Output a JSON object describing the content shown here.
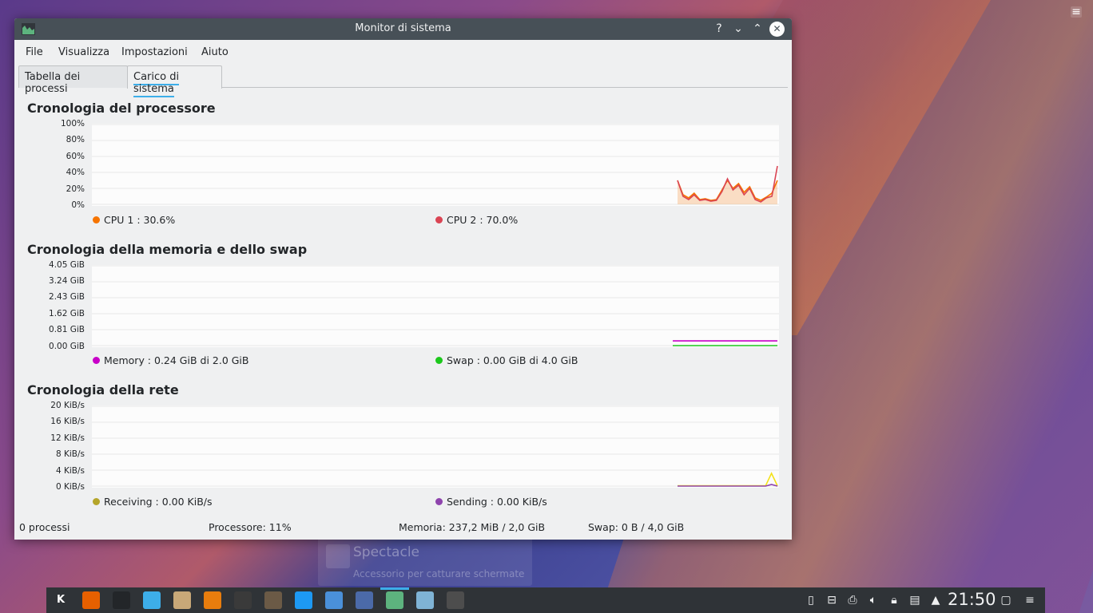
{
  "window": {
    "title": "Monitor di sistema",
    "controls": {
      "help": "?",
      "minimize": "⌄",
      "maximize": "⌃",
      "close": "✕"
    }
  },
  "menubar": {
    "items": [
      "File",
      "Visualizza",
      "Impostazioni",
      "Aiuto"
    ]
  },
  "tabs": [
    {
      "label": "Tabella dei processi",
      "active": false
    },
    {
      "label": "Carico di sistema",
      "active": true
    }
  ],
  "cpu": {
    "title": "Cronologia del processore",
    "yticks": [
      "100%",
      "80%",
      "60%",
      "40%",
      "20%",
      "0%"
    ],
    "legend": [
      {
        "label": "CPU 1 : 30.6%",
        "color": "#f67400"
      },
      {
        "label": "CPU 2 : 70.0%",
        "color": "#da4453"
      }
    ]
  },
  "memory": {
    "title": "Cronologia della memoria e dello swap",
    "yticks": [
      "4.05 GiB",
      "3.24 GiB",
      "2.43 GiB",
      "1.62 GiB",
      "0.81 GiB",
      "0.00 GiB"
    ],
    "legend": [
      {
        "label": "Memory : 0.24 GiB di 2.0 GiB",
        "color": "#c800c8"
      },
      {
        "label": "Swap : 0.00 GiB di 4.0 GiB",
        "color": "#1cc81c"
      }
    ]
  },
  "network": {
    "title": "Cronologia della rete",
    "yticks": [
      "20 KiB/s",
      "16 KiB/s",
      "12 KiB/s",
      "8 KiB/s",
      "4 KiB/s",
      "0 KiB/s"
    ],
    "legend": [
      {
        "label": "Receiving : 0.00 KiB/s",
        "color": "#b5a52a"
      },
      {
        "label": "Sending : 0.00 KiB/s",
        "color": "#8e44ad"
      }
    ]
  },
  "chart_data": [
    {
      "type": "area",
      "title": "Cronologia del processore",
      "ylim": [
        0,
        100
      ],
      "yunit": "%",
      "series": [
        {
          "name": "CPU 1",
          "values": [
            30,
            12,
            8,
            14,
            6,
            7,
            5,
            6,
            18,
            30,
            20,
            26,
            15,
            22,
            8,
            5,
            9,
            14,
            30
          ]
        },
        {
          "name": "CPU 2",
          "values": [
            30,
            10,
            6,
            12,
            5,
            6,
            4,
            5,
            16,
            32,
            18,
            24,
            12,
            20,
            6,
            3,
            8,
            10,
            48
          ]
        }
      ]
    },
    {
      "type": "line",
      "title": "Cronologia della memoria e dello swap",
      "ylim": [
        0,
        4.05
      ],
      "yunit": "GiB",
      "series": [
        {
          "name": "Memory",
          "values": [
            0.24,
            0.24,
            0.24,
            0.24,
            0.24,
            0.24,
            0.24,
            0.24,
            0.24,
            0.24
          ]
        },
        {
          "name": "Swap",
          "values": [
            0.0,
            0.0,
            0.0,
            0.0,
            0.0,
            0.0,
            0.0,
            0.0,
            0.0,
            0.0
          ]
        }
      ]
    },
    {
      "type": "line",
      "title": "Cronologia della rete",
      "ylim": [
        0,
        20
      ],
      "yunit": "KiB/s",
      "series": [
        {
          "name": "Receiving",
          "values": [
            0.1,
            0.1,
            0.1,
            0.1,
            0.1,
            0.1,
            0.1,
            0.1,
            0.1,
            0.1,
            0.1,
            0.1,
            0.1,
            0.1,
            0.1,
            0.1,
            3.2,
            0.1
          ]
        },
        {
          "name": "Sending",
          "values": [
            0.0,
            0.0,
            0.0,
            0.0,
            0.0,
            0.0,
            0.0,
            0.0,
            0.0,
            0.0,
            0.0,
            0.0,
            0.0,
            0.0,
            0.0,
            0.0,
            0.4,
            0.0
          ]
        }
      ]
    }
  ],
  "statusbar": {
    "processes": "0 processi",
    "cpu": "Processore: 11%",
    "memory": "Memoria: 237,2 MiB / 2,0 GiB",
    "swap": "Swap: 0 B / 4,0 GiB"
  },
  "background_notification": {
    "title": "Spectacle",
    "subtitle": "Accessorio per catturare schermate"
  },
  "taskbar": {
    "launchers": [
      {
        "name": "application-launcher-icon",
        "glyph": "K",
        "color": "#2f3337"
      },
      {
        "name": "firefox-icon",
        "glyph": "",
        "color": "#e66000"
      },
      {
        "name": "terminal-icon",
        "glyph": "",
        "color": "#232629"
      },
      {
        "name": "software-store-icon",
        "glyph": "",
        "color": "#3daee9"
      },
      {
        "name": "archive-icon",
        "glyph": "",
        "color": "#c8a878"
      },
      {
        "name": "blender-icon",
        "glyph": "",
        "color": "#e87d0d"
      },
      {
        "name": "inkscape-icon",
        "glyph": "",
        "color": "#3a3a3a"
      },
      {
        "name": "gimp-icon",
        "glyph": "",
        "color": "#6b5a46"
      },
      {
        "name": "file-manager-icon",
        "glyph": "",
        "color": "#1d99f3"
      },
      {
        "name": "chromium-icon",
        "glyph": "",
        "color": "#4a90d9"
      },
      {
        "name": "kdenlive-icon",
        "glyph": "",
        "color": "#4b6aa8"
      },
      {
        "name": "system-monitor-icon",
        "glyph": "",
        "color": "#5db37e"
      },
      {
        "name": "screen-icon",
        "glyph": "",
        "color": "#7fb3d5"
      },
      {
        "name": "console-icon",
        "glyph": "",
        "color": "#4d4d4d"
      }
    ],
    "clock": "21:50"
  }
}
